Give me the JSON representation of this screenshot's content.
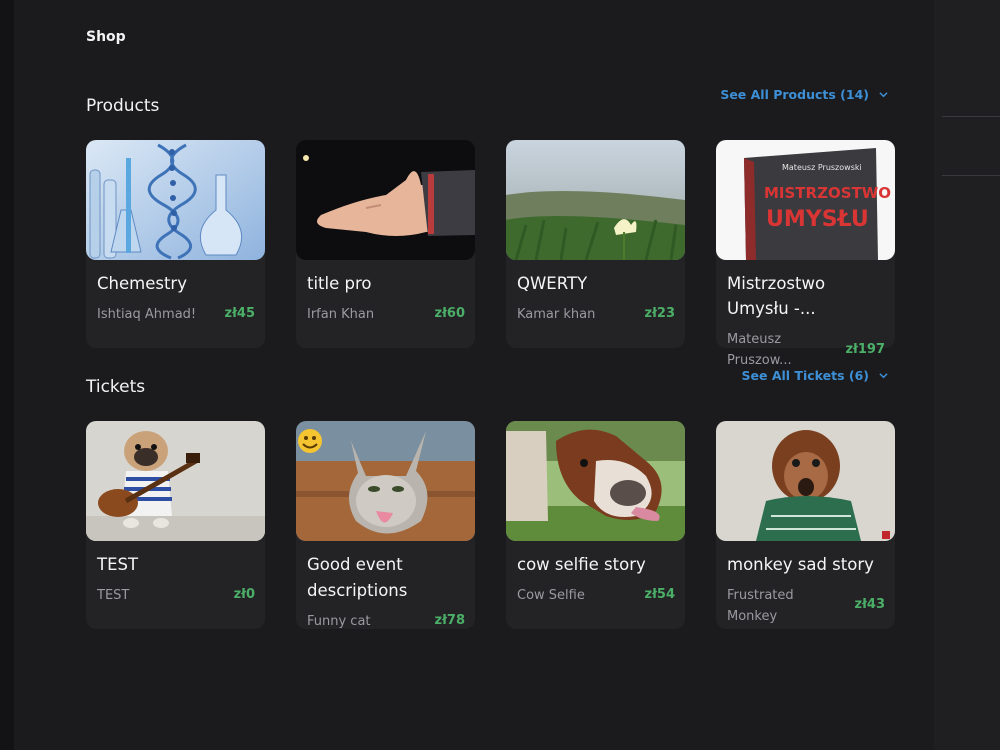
{
  "header": {
    "title": "Shop"
  },
  "products": {
    "title": "Products",
    "see_all": "See All Products (14)",
    "items": [
      {
        "title": "Chemestry",
        "seller": "Ishtiaq Ahmad!",
        "price": "zł45",
        "image": "chemistry-lab-image"
      },
      {
        "title": "title pro",
        "seller": "Irfan Khan",
        "price": "zł60",
        "image": "hand-image"
      },
      {
        "title": "QWERTY",
        "seller": "Kamar khan",
        "price": "zł23",
        "image": "grass-flower-image"
      },
      {
        "title": "Mistrzostwo Umysłu -...",
        "seller": "Mateusz Pruszow...",
        "price": "zł197",
        "image": "book-cover-image",
        "book": {
          "author": "Mateusz Pruszowski",
          "line1": "MISTRZOSTWO",
          "line2": "UMYSŁU"
        }
      }
    ]
  },
  "tickets": {
    "title": "Tickets",
    "see_all": "See All Tickets (6)",
    "items": [
      {
        "title": "TEST",
        "seller": "TEST",
        "price": "zł0",
        "image": "pug-guitar-image"
      },
      {
        "title": "Good event descriptions",
        "seller": "Funny cat",
        "price": "zł78",
        "image": "cat-tongue-image"
      },
      {
        "title": "cow selfie story",
        "seller": "Cow Selfie",
        "price": "zł54",
        "image": "cow-selfie-image"
      },
      {
        "title": "monkey sad story",
        "seller": "Frustrated Monkey",
        "price": "zł43",
        "image": "monkey-image"
      }
    ]
  },
  "colors": {
    "accent": "#3d8fd6",
    "price": "#4caf68",
    "card": "#232326",
    "background": "#1b1b1e"
  }
}
